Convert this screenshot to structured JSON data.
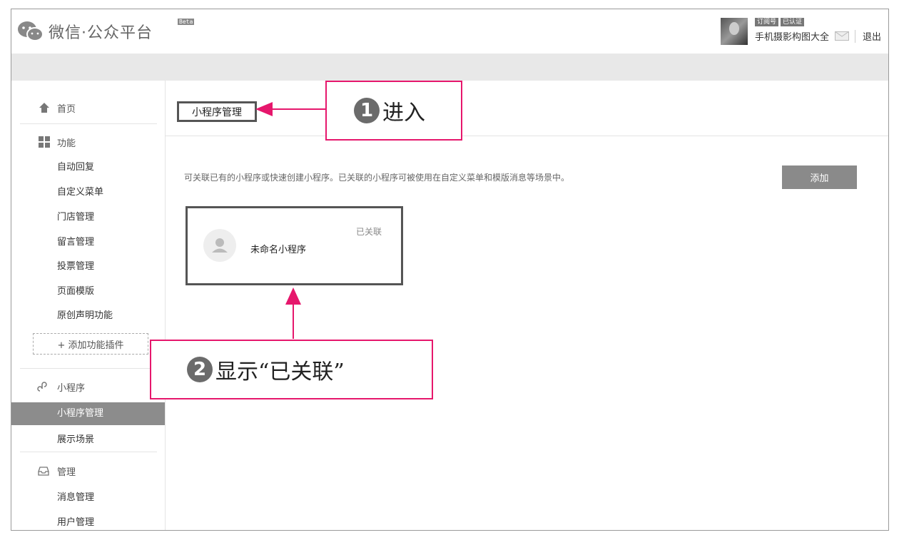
{
  "header": {
    "logo_text": "微信·公众平台",
    "beta": "Beta",
    "account": {
      "badge_type": "订阅号",
      "badge_verified": "已认证",
      "name": "手机摄影构图大全",
      "logout": "退出"
    }
  },
  "sidebar": {
    "home": "首页",
    "feature_section": "功能",
    "feature_items": [
      "自动回复",
      "自定义菜单",
      "门店管理",
      "留言管理",
      "投票管理",
      "页面模版",
      "原创声明功能"
    ],
    "add_plugin": "+ 添加功能插件",
    "mini_section": "小程序",
    "mini_items": [
      "小程序管理",
      "展示场景"
    ],
    "manage_section": "管理",
    "manage_items": [
      "消息管理",
      "用户管理"
    ]
  },
  "main": {
    "tab_label": "小程序管理",
    "description": "可关联已有的小程序或快速创建小程序。已关联的小程序可被使用在自定义菜单和模版消息等场景中。",
    "add_button": "添加",
    "card": {
      "name": "未命名小程序",
      "status": "已关联"
    }
  },
  "annotations": {
    "step1_num": "1",
    "step1_text": "进入",
    "step2_num": "2",
    "step2_text": "显示“已关联”"
  },
  "colors": {
    "annotation": "#e6176c",
    "active_nav": "#8c8c8c",
    "button": "#8a8a8a"
  }
}
